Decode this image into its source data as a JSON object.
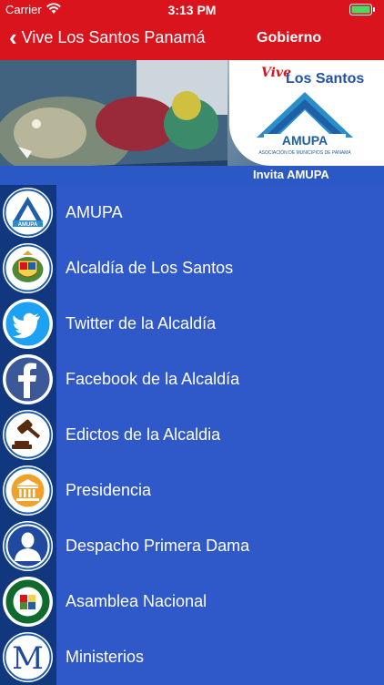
{
  "status_bar": {
    "carrier": "Carrier",
    "time": "3:13 PM"
  },
  "nav": {
    "back_label": "Vive Los Santos Panamá",
    "title": "Gobierno"
  },
  "banner": {
    "vive": "Vive",
    "los_santos": "Los Santos",
    "logo_text": "AMUPA",
    "logo_subtitle": "ASOCIACIÓN DE MUNICIPIOS DE PANAMÁ",
    "invite": "Invita  AMUPA"
  },
  "menu": [
    {
      "label": "AMUPA",
      "icon": "amupa-logo-icon"
    },
    {
      "label": "Alcaldía de Los Santos",
      "icon": "coat-of-arms-icon"
    },
    {
      "label": "Twitter de la Alcaldía",
      "icon": "twitter-icon"
    },
    {
      "label": "Facebook de la  Alcaldía",
      "icon": "facebook-icon"
    },
    {
      "label": "Edictos de la Alcaldia",
      "icon": "gavel-icon"
    },
    {
      "label": "Presidencia",
      "icon": "government-building-icon"
    },
    {
      "label": "Despacho Primera Dama",
      "icon": "person-silhouette-icon"
    },
    {
      "label": "Asamblea Nacional",
      "icon": "asamblea-seal-icon"
    },
    {
      "label": "Ministerios",
      "icon": "ministerios-m-icon"
    }
  ],
  "colors": {
    "nav_red": "#d9141c",
    "list_blue": "#2f58c9",
    "icon_column_blue": "#11377f"
  }
}
